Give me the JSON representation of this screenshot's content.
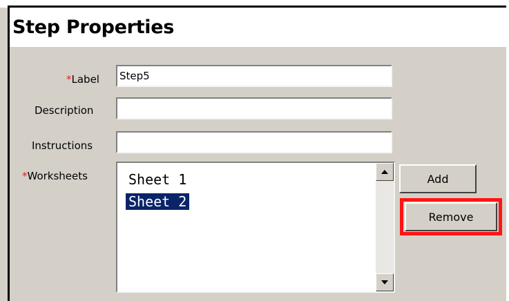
{
  "panel": {
    "title": "Step Properties"
  },
  "form": {
    "required_marker": "*",
    "label": {
      "label": "Label",
      "value": "Step5"
    },
    "description": {
      "label": "Description",
      "value": ""
    },
    "instructions": {
      "label": "Instructions",
      "value": ""
    },
    "worksheets": {
      "label": "Worksheets",
      "items": [
        {
          "text": "Sheet 1",
          "selected": false
        },
        {
          "text": "Sheet 2",
          "selected": true
        }
      ]
    }
  },
  "buttons": {
    "add": "Add",
    "remove": "Remove"
  },
  "colors": {
    "required": "#e02020",
    "selection": "#0a246a",
    "highlight_box": "#ff1414",
    "panel_bg": "#d4d0c8"
  },
  "icons": {
    "scroll_up": "scroll-up-arrow-icon",
    "scroll_down": "scroll-down-arrow-icon"
  }
}
